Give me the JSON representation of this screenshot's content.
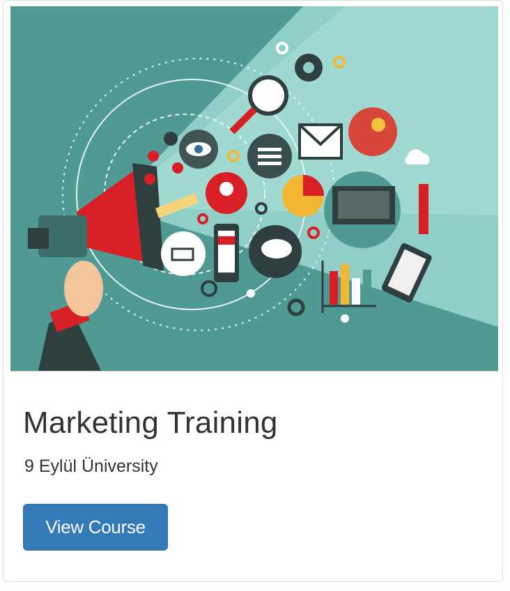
{
  "course_card": {
    "image": {
      "icon": "marketing-megaphone-illustration",
      "colors": {
        "background": "#6fb3ad",
        "beam": "#9fd6d0",
        "megaphone": "#d81f26",
        "dark": "#2f3e3e"
      }
    },
    "title": "Marketing Training",
    "institution": "9 Eylül Üniversity",
    "button_label": "View Course",
    "button_color": "#337ab7"
  }
}
